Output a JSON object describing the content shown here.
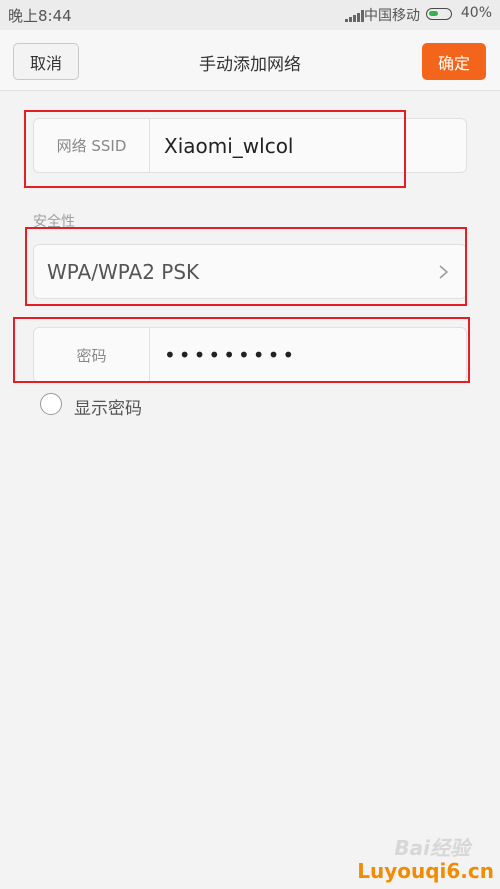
{
  "status_bar": {
    "time": "晚上8:44",
    "carrier": "中国移动",
    "battery_percent": "40%",
    "battery_level": 0.4
  },
  "header": {
    "cancel_label": "取消",
    "title": "手动添加网络",
    "confirm_label": "确定"
  },
  "form": {
    "ssid_label": "网络 SSID",
    "ssid_value": "Xiaomi_wlcol",
    "security_section_label": "安全性",
    "security_value": "WPA/WPA2 PSK",
    "password_label": "密码",
    "password_masked": "•••••••••",
    "show_password_label": "显示密码",
    "show_password_checked": false
  },
  "watermark": {
    "baidu_text": "Bai经验",
    "site_text": "Luyouqi6.cn"
  },
  "colors": {
    "accent": "#f2651a",
    "highlight": "#e51d24",
    "battery": "#36b24a"
  }
}
